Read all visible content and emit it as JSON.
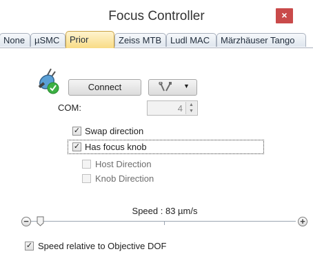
{
  "window": {
    "title": "Focus Controller",
    "close_glyph": "×"
  },
  "tabs": [
    {
      "label": "None",
      "active": false
    },
    {
      "label": "µSMC",
      "active": false
    },
    {
      "label": "Prior",
      "active": true
    },
    {
      "label": "Zeiss MTB",
      "active": false
    },
    {
      "label": "Ludl MAC",
      "active": false
    },
    {
      "label": "Märzhäuser Tango",
      "active": false
    }
  ],
  "device": {
    "icon": "connected-device-icon",
    "connect_label": "Connect",
    "tools_icon": "wrench-screwdriver-icon",
    "dropdown_icon": "chevron-down-icon",
    "com_label": "COM:",
    "com_value": "4"
  },
  "options": {
    "swap_direction": {
      "label": "Swap direction",
      "checked": true
    },
    "has_focus_knob": {
      "label": "Has focus knob",
      "checked": true
    },
    "host_direction": {
      "label": "Host Direction",
      "checked": false,
      "enabled": false
    },
    "knob_direction": {
      "label": "Knob Direction",
      "checked": false,
      "enabled": false
    }
  },
  "speed": {
    "label": "Speed : 83 µm/s",
    "value": 83,
    "unit": "µm/s",
    "decrease_icon": "minus-circle-icon",
    "increase_icon": "plus-circle-icon",
    "decrease_glyph": "−",
    "increase_glyph": "+"
  },
  "speed_relative": {
    "label": "Speed relative to Objective DOF",
    "checked": true
  },
  "colors": {
    "close_button": "#c94a4a",
    "active_tab": "#f8dc85",
    "tab_border": "#a8b0bd",
    "check_green": "#3cb043"
  }
}
